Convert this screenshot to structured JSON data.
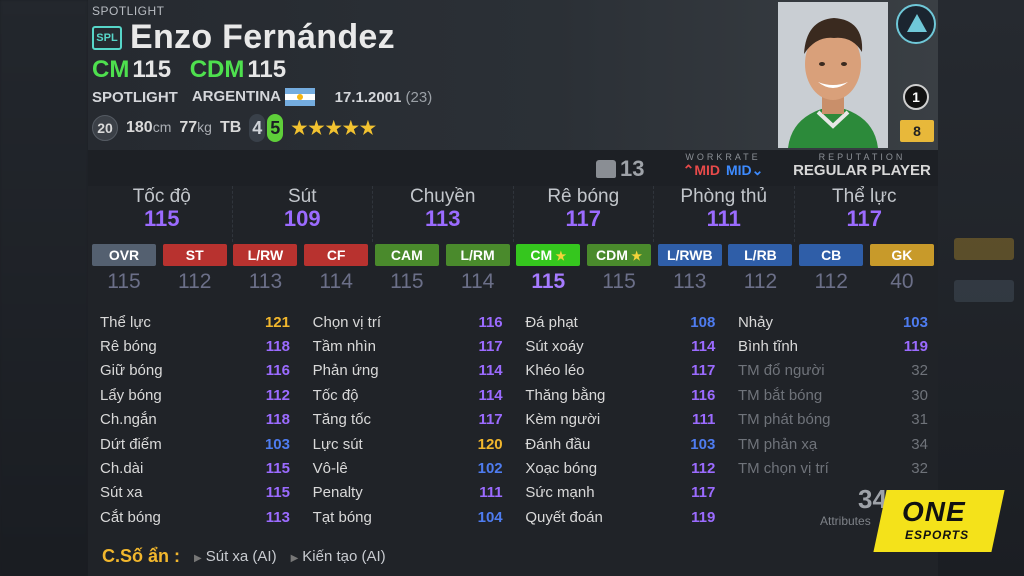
{
  "card": {
    "season_label": "SPOTLIGHT",
    "season_badge": "SPL",
    "player_name": "Enzo Fernández",
    "positions": [
      {
        "code": "CM",
        "value": "115"
      },
      {
        "code": "CDM",
        "value": "115"
      }
    ],
    "meta": {
      "season": "SPOTLIGHT",
      "nation": "ARGENTINA",
      "birthdate": "17.1.2001",
      "age": "(23)"
    },
    "physical": {
      "shirt_circle": "20",
      "height": "180",
      "height_unit": "cm",
      "weight": "77",
      "weight_unit": "kg",
      "body_type": "TB",
      "weak_foot": "4",
      "strong_foot": "5",
      "stars": "★★★★★"
    },
    "rank": "1",
    "level": "8"
  },
  "info": {
    "jersey_number": "13",
    "workrate_label": "WORKRATE",
    "workrate_att": "MID",
    "workrate_def": "MID",
    "workrate_att_arrow": "⌃",
    "workrate_def_arrow": "⌄",
    "reputation_label": "REPUTATION",
    "reputation_value": "REGULAR PLAYER"
  },
  "main_stats": [
    {
      "label": "Tốc độ",
      "value": "115"
    },
    {
      "label": "Sút",
      "value": "109"
    },
    {
      "label": "Chuyền",
      "value": "113"
    },
    {
      "label": "Rê bóng",
      "value": "117"
    },
    {
      "label": "Phòng thủ",
      "value": "111"
    },
    {
      "label": "Thể lực",
      "value": "117"
    }
  ],
  "position_ratings": [
    {
      "pos": "OVR",
      "value": "115",
      "color": "#546070"
    },
    {
      "pos": "ST",
      "value": "112",
      "color": "#b8322f"
    },
    {
      "pos": "L/RW",
      "value": "113",
      "color": "#b8322f"
    },
    {
      "pos": "CF",
      "value": "114",
      "color": "#b8322f"
    },
    {
      "pos": "CAM",
      "value": "115",
      "color": "#4a8a2c"
    },
    {
      "pos": "L/RM",
      "value": "114",
      "color": "#4a8a2c"
    },
    {
      "pos": "CM",
      "value": "115",
      "color": "#35c61e",
      "starred": true
    },
    {
      "pos": "CDM",
      "value": "115",
      "color": "#4a8a2c",
      "starred": true
    },
    {
      "pos": "L/RWB",
      "value": "113",
      "color": "#2f5ea8"
    },
    {
      "pos": "L/RB",
      "value": "112",
      "color": "#2f5ea8"
    },
    {
      "pos": "CB",
      "value": "112",
      "color": "#2f5ea8"
    },
    {
      "pos": "GK",
      "value": "40",
      "color": "#c89a2a"
    }
  ],
  "attributes": {
    "col1": [
      {
        "name": "Thể lực",
        "value": "121",
        "tone": "gold"
      },
      {
        "name": "Rê bóng",
        "value": "118",
        "tone": "purple"
      },
      {
        "name": "Giữ bóng",
        "value": "116",
        "tone": "purple"
      },
      {
        "name": "Lẩy bóng",
        "value": "112",
        "tone": "purple"
      },
      {
        "name": "Ch.ngắn",
        "value": "118",
        "tone": "purple"
      },
      {
        "name": "Dứt điểm",
        "value": "103",
        "tone": "blue"
      },
      {
        "name": "Ch.dài",
        "value": "115",
        "tone": "purple"
      },
      {
        "name": "Sút xa",
        "value": "115",
        "tone": "purple"
      },
      {
        "name": "Cắt bóng",
        "value": "113",
        "tone": "purple"
      }
    ],
    "col2": [
      {
        "name": "Chọn vị trí",
        "value": "116",
        "tone": "purple"
      },
      {
        "name": "Tầm nhìn",
        "value": "117",
        "tone": "purple"
      },
      {
        "name": "Phản ứng",
        "value": "114",
        "tone": "purple"
      },
      {
        "name": "Tốc độ",
        "value": "114",
        "tone": "purple"
      },
      {
        "name": "Tăng tốc",
        "value": "117",
        "tone": "purple"
      },
      {
        "name": "Lực sút",
        "value": "120",
        "tone": "gold"
      },
      {
        "name": "Vô-lê",
        "value": "102",
        "tone": "blue"
      },
      {
        "name": "Penalty",
        "value": "111",
        "tone": "purple"
      },
      {
        "name": "Tạt bóng",
        "value": "104",
        "tone": "blue"
      }
    ],
    "col3": [
      {
        "name": "Đá phạt",
        "value": "108",
        "tone": "blue"
      },
      {
        "name": "Sút xoáy",
        "value": "114",
        "tone": "purple"
      },
      {
        "name": "Khéo léo",
        "value": "117",
        "tone": "purple"
      },
      {
        "name": "Thăng bằng",
        "value": "116",
        "tone": "purple"
      },
      {
        "name": "Kèm người",
        "value": "111",
        "tone": "purple"
      },
      {
        "name": "Đánh đầu",
        "value": "103",
        "tone": "blue"
      },
      {
        "name": "Xoạc bóng",
        "value": "112",
        "tone": "purple"
      },
      {
        "name": "Sức mạnh",
        "value": "117",
        "tone": "purple"
      },
      {
        "name": "Quyết đoán",
        "value": "119",
        "tone": "purple"
      }
    ],
    "col4": [
      {
        "name": "Nhảy",
        "value": "103",
        "tone": "blue"
      },
      {
        "name": "Bình tĩnh",
        "value": "119",
        "tone": "purple"
      },
      {
        "name": "TM đổ người",
        "value": "32",
        "tone": "gk"
      },
      {
        "name": "TM bắt bóng",
        "value": "30",
        "tone": "gk"
      },
      {
        "name": "TM phát bóng",
        "value": "31",
        "tone": "gk"
      },
      {
        "name": "TM phản xạ",
        "value": "34",
        "tone": "gk"
      },
      {
        "name": "TM chọn vị trí",
        "value": "32",
        "tone": "gk"
      }
    ]
  },
  "total": {
    "value": "34",
    "label": "Attributes"
  },
  "hidden_traits": {
    "label": "C.Số ẩn :",
    "items": [
      "Sút xa (AI)",
      "Kiến tạo (AI)"
    ]
  },
  "watermark": {
    "brand": "ONE",
    "sub": "ESPORTS"
  },
  "colors": {
    "accent_purple": "#9b6bff",
    "accent_blue": "#4e7cf0",
    "accent_gold": "#f2b72d",
    "position_green": "#4ee04e"
  }
}
